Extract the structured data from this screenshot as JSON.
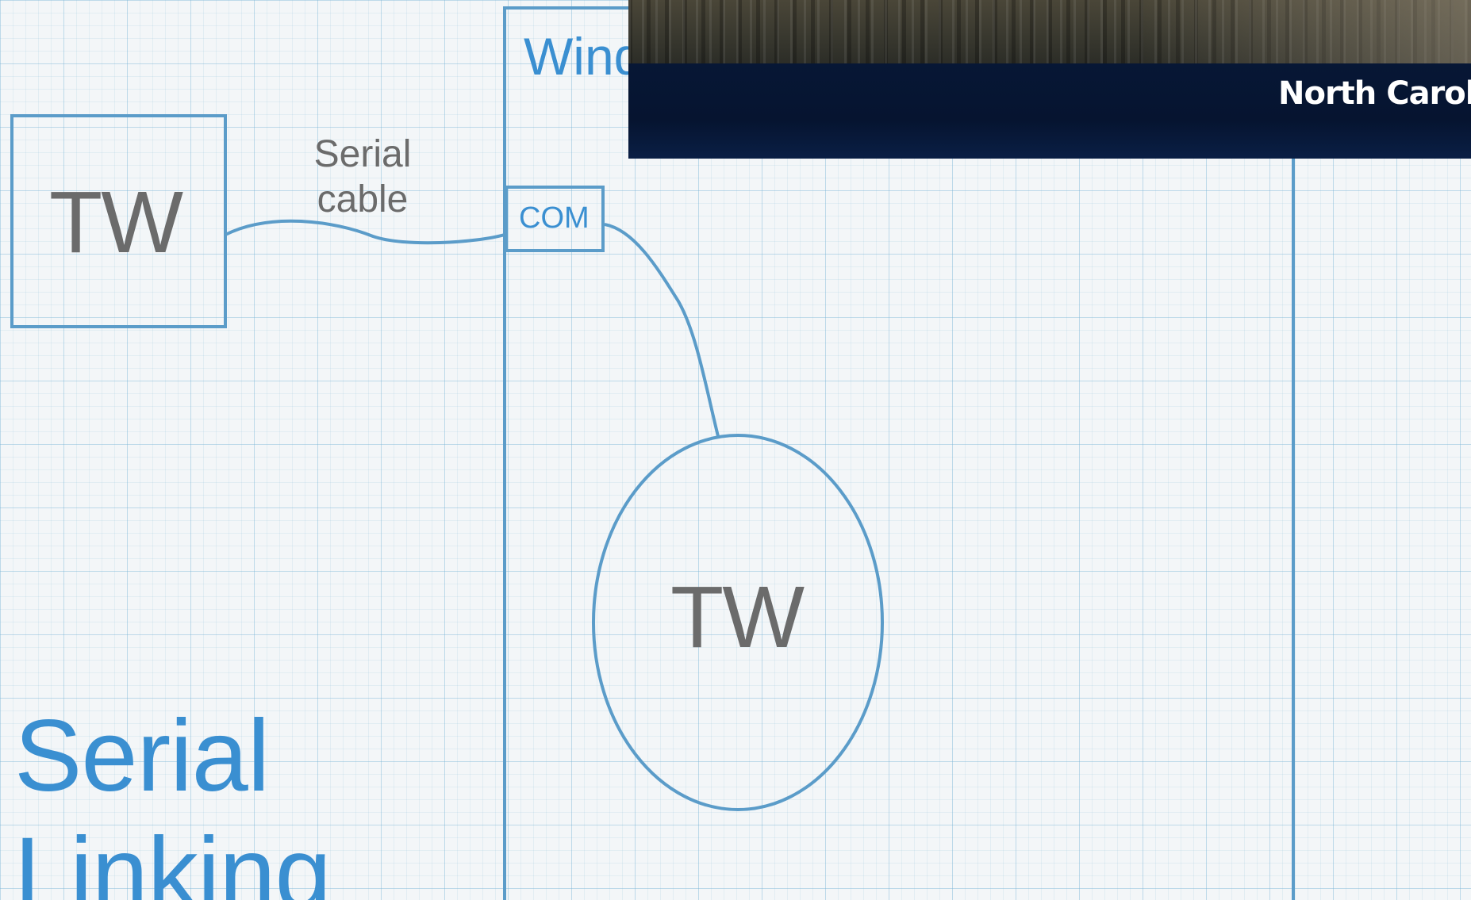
{
  "diagram": {
    "external_node": {
      "label": "TW"
    },
    "cable_label": "Serial\ncable",
    "windows_box": {
      "label": "Wind"
    },
    "com_port": {
      "label": "COM"
    },
    "internal_node": {
      "label": "TW"
    },
    "title": "Serial\nLinking"
  },
  "banner": {
    "text": "North Caroli"
  },
  "colors": {
    "accent": "#3a8fd1",
    "outline": "#5b9cc9",
    "node_text": "#6b6b6b",
    "banner_bg": "#061430"
  }
}
